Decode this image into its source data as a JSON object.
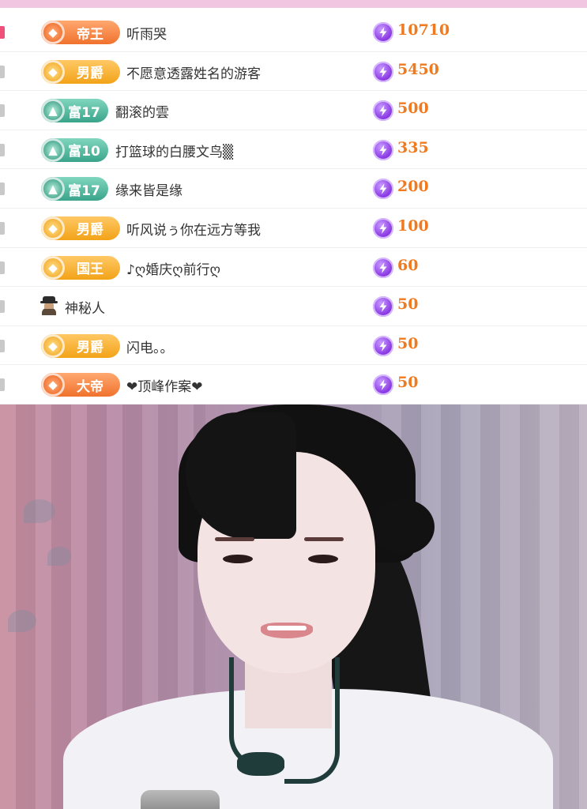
{
  "ranking": {
    "rows": [
      {
        "badge_style": "orange",
        "badge_icon": "crest-icon",
        "badge_label": "帝王",
        "name": "听雨哭",
        "amount": "10710",
        "first": true
      },
      {
        "badge_style": "gold",
        "badge_icon": "crest-icon",
        "badge_label": "男爵",
        "name": "不愿意透露姓名的游客",
        "amount": "5450"
      },
      {
        "badge_style": "green",
        "badge_icon": "triangle-icon",
        "badge_label": "富17",
        "name": "翻滚的雲",
        "amount": "500"
      },
      {
        "badge_style": "green",
        "badge_icon": "triangle-icon",
        "badge_label": "富10",
        "name": "打篮球的白腰文鸟▒",
        "amount": "335"
      },
      {
        "badge_style": "green",
        "badge_icon": "triangle-icon",
        "badge_label": "富17",
        "name": "缘来皆是缘",
        "amount": "200"
      },
      {
        "badge_style": "gold",
        "badge_icon": "crest-icon",
        "badge_label": "男爵",
        "name": "听风说ぅ你在远方等我",
        "amount": "100"
      },
      {
        "badge_style": "gold",
        "badge_icon": "crest-icon",
        "badge_label": "国王",
        "name": "♪ღ婚庆ღ前行ღ",
        "amount": "60"
      },
      {
        "badge_style": "mystery",
        "badge_icon": "mystery-person-icon",
        "badge_label": "",
        "name": "神秘人",
        "amount": "50"
      },
      {
        "badge_style": "gold",
        "badge_icon": "crest-icon",
        "badge_label": "男爵",
        "name": "闪电。。",
        "amount": "50"
      },
      {
        "badge_style": "orange",
        "badge_icon": "crest-icon",
        "badge_label": "大帝",
        "name": "❤顶峰作案❤",
        "amount": "50"
      }
    ],
    "coin_icon": "lightning-coin-icon"
  },
  "colors": {
    "top_strip": "#f1c6e1",
    "amount_text": "#f07a1f",
    "coin": "#8b3be4",
    "first_marker": "#f0517a"
  },
  "stream": {
    "icon": "live-video-frame"
  }
}
